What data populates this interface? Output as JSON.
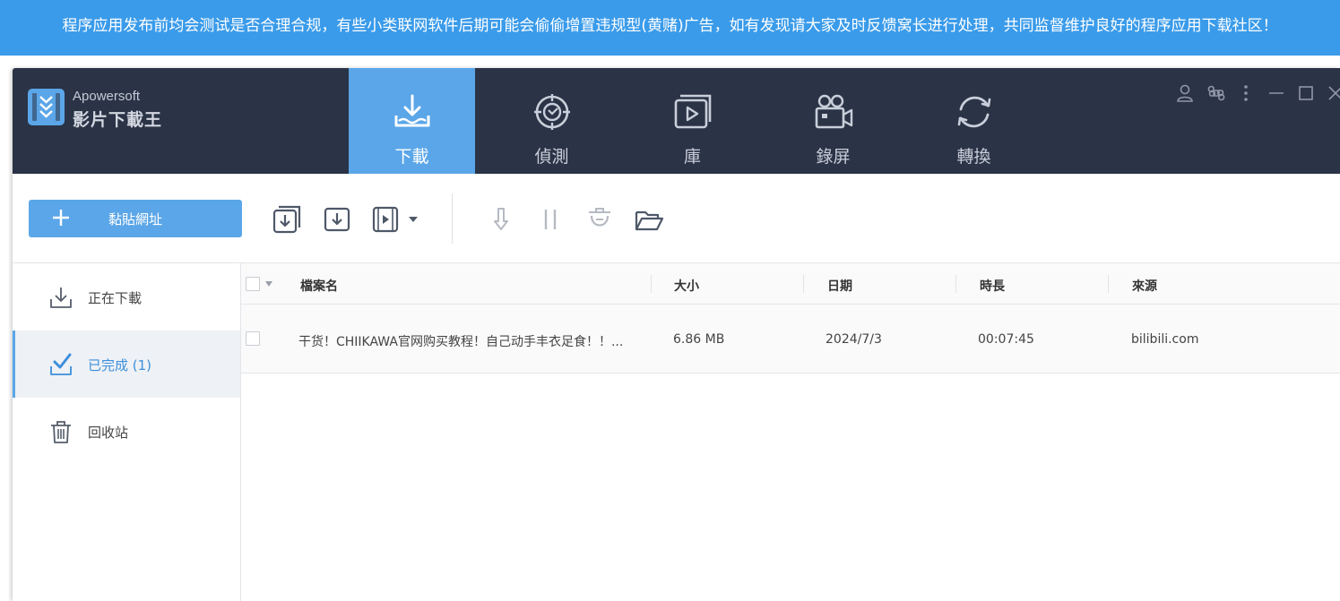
{
  "banner": {
    "text": "程序应用发布前均会测试是否合理合规，有些小类联网软件后期可能会偷偷增置违规型(黄赌)广告，如有发现请大家及时反馈窝长进行处理，共同监督维护良好的程序应用下载社区！"
  },
  "app": {
    "brand_en": "Apowersoft",
    "brand_cn": "影片下載王"
  },
  "nav": {
    "tabs": [
      {
        "label": "下載",
        "icon": "download-tray-icon"
      },
      {
        "label": "偵測",
        "icon": "detect-target-icon"
      },
      {
        "label": "庫",
        "icon": "library-play-icon"
      },
      {
        "label": "錄屏",
        "icon": "video-camera-icon"
      },
      {
        "label": "轉換",
        "icon": "convert-cycle-icon"
      }
    ],
    "active_tab": "下載"
  },
  "window_controls": [
    "user-icon",
    "shortcut-icon",
    "more-vertical-icon",
    "minimize-icon",
    "maximize-icon",
    "close-icon"
  ],
  "toolbar": {
    "paste_label": "黏貼網址",
    "icons": [
      "batch-download-icon",
      "download-icon",
      "video-download-icon",
      "resume-icon",
      "pause-icon",
      "delete-icon",
      "open-folder-icon"
    ]
  },
  "sidebar": {
    "items": [
      {
        "label": "正在下載",
        "icon": "download-icon"
      },
      {
        "label": "已完成 (1)",
        "icon": "check-tray-icon"
      },
      {
        "label": "回收站",
        "icon": "trash-icon"
      }
    ],
    "active_index": 1
  },
  "table": {
    "columns": [
      "檔案名",
      "大小",
      "日期",
      "時長",
      "來源"
    ],
    "rows": [
      {
        "name": "干货！CHIIKAWA官网购买教程！自己动手丰衣足食！！...",
        "size": "6.86 MB",
        "date": "2024/7/3",
        "duration": "00:07:45",
        "source": "bilibili.com"
      }
    ]
  },
  "colors": {
    "banner": "#3a9bea",
    "titlebar": "#2b3346",
    "accent": "#5ba6e8",
    "active_text": "#3d8fdc"
  }
}
